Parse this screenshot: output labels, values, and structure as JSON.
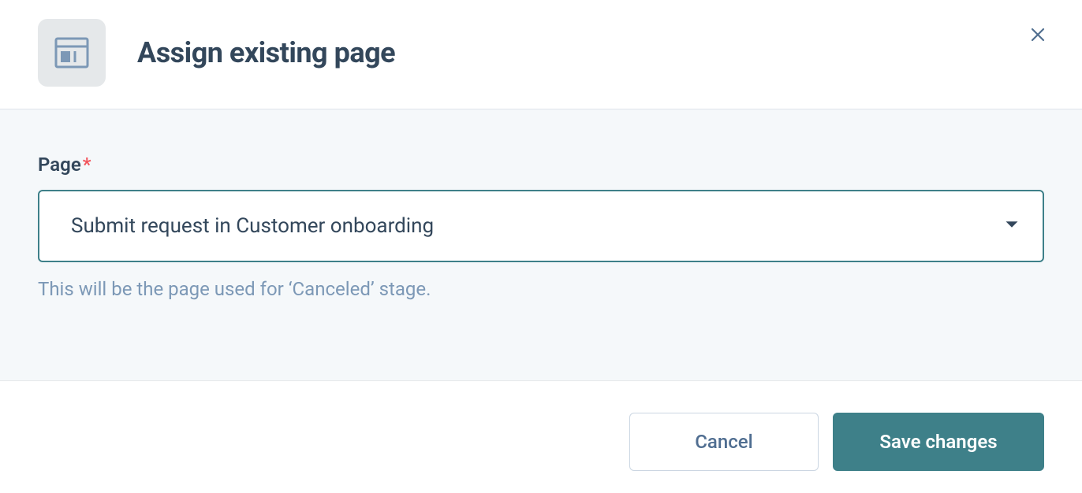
{
  "header": {
    "title": "Assign existing page"
  },
  "form": {
    "page_label": "Page",
    "required_marker": "*",
    "page_selected_value": "Submit request in Customer onboarding",
    "help_text": "This will be the page used for ‘Canceled’ stage."
  },
  "footer": {
    "cancel_label": "Cancel",
    "save_label": "Save changes"
  }
}
